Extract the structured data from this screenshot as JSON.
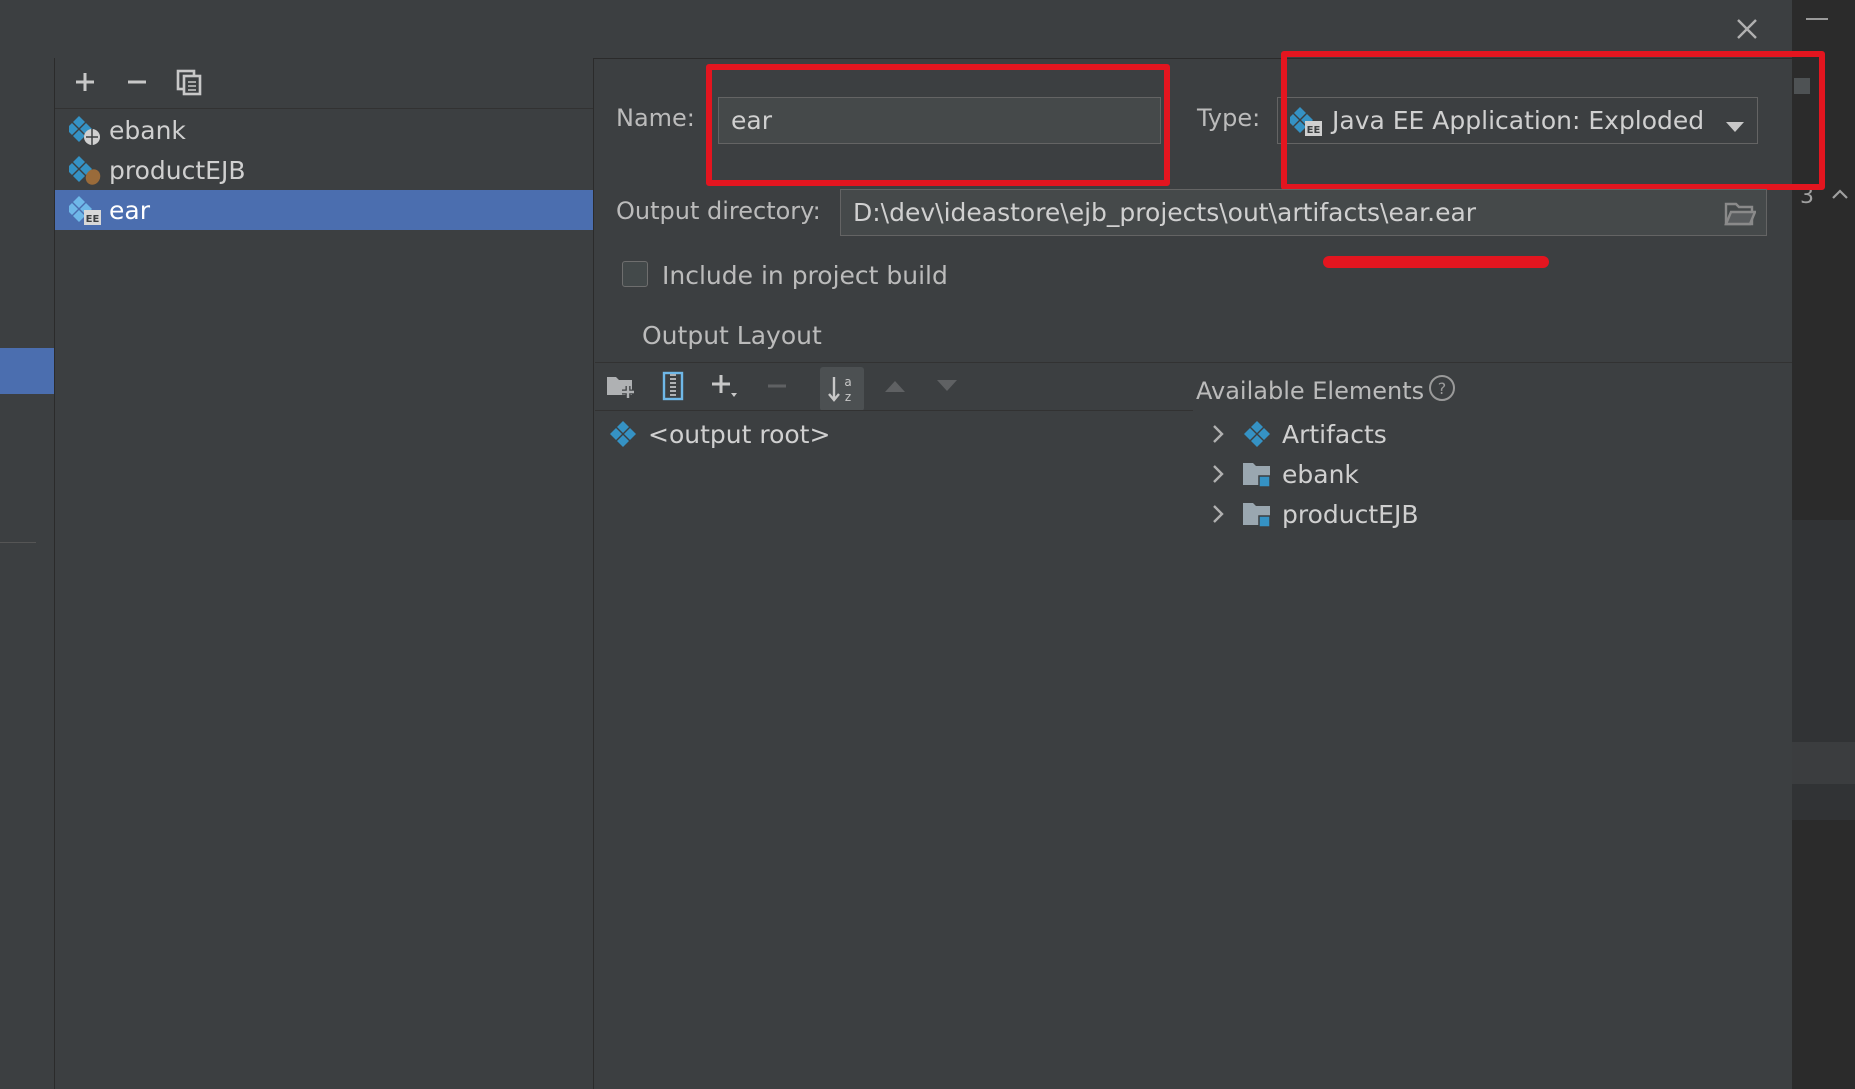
{
  "dialog": {
    "close_icon": "close-icon"
  },
  "background_window": {
    "line_number": "3"
  },
  "artifact_list": {
    "toolbar": {
      "add_icon": "plus-icon",
      "remove_icon": "minus-icon",
      "copy_icon": "copy-icon"
    },
    "items": [
      {
        "label": "ebank",
        "icon": "web-artifact-icon",
        "selected": false
      },
      {
        "label": "productEJB",
        "icon": "ejb-artifact-icon",
        "selected": false
      },
      {
        "label": "ear",
        "icon": "javaee-artifact-icon",
        "selected": true
      }
    ]
  },
  "form": {
    "name_label": "Name:",
    "name_value": "ear",
    "type_label": "Type:",
    "type_value": "Java EE Application: Exploded",
    "output_dir_label": "Output directory:",
    "output_dir_value": "D:\\dev\\ideastore\\ejb_projects\\out\\artifacts\\ear.ear",
    "include_label": "Include in project build",
    "include_checked": false
  },
  "output_layout": {
    "title": "Output Layout",
    "toolbar_icons": [
      "new-folder-icon",
      "archive-icon",
      "add-icon",
      "remove-icon",
      "sort-icon",
      "move-up-icon",
      "move-down-icon"
    ],
    "root_label": "<output root>"
  },
  "available_elements": {
    "title": "Available Elements",
    "help_icon": "help-icon",
    "items": [
      {
        "label": "Artifacts",
        "icon": "artifacts-icon"
      },
      {
        "label": "ebank",
        "icon": "module-folder-icon"
      },
      {
        "label": "productEJB",
        "icon": "module-folder-icon"
      }
    ]
  },
  "colors": {
    "background": "#3c3f41",
    "selection": "#4b6eaf",
    "annotation_red": "#e3151f",
    "icon_blue": "#3592c4"
  }
}
